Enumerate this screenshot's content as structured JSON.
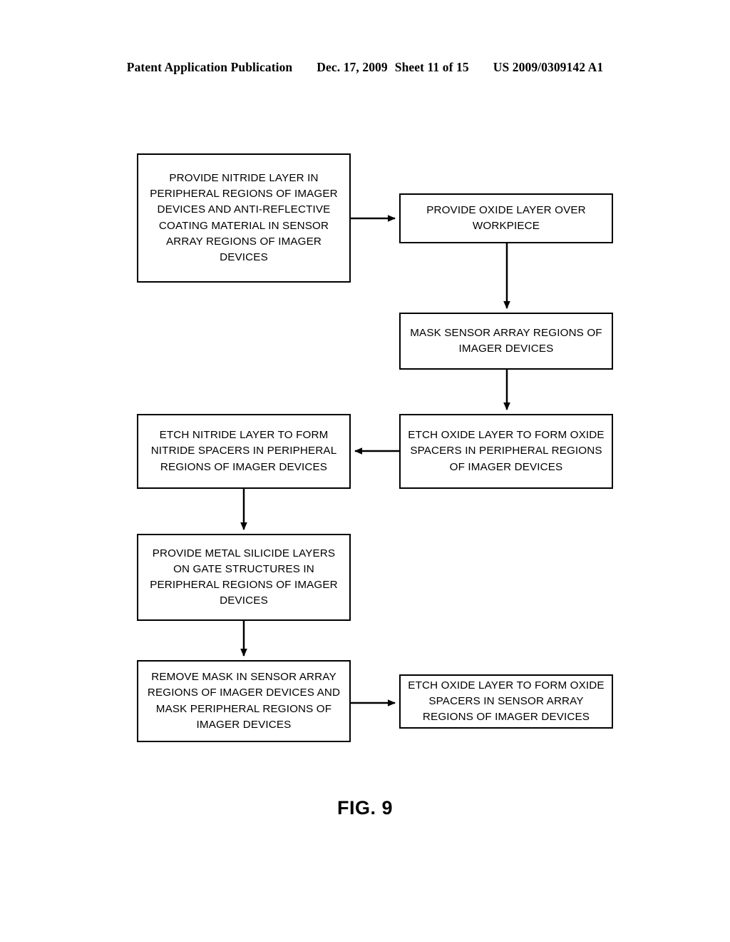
{
  "header": {
    "publication": "Patent Application Publication",
    "date": "Dec. 17, 2009",
    "sheet": "Sheet 11 of 15",
    "document_number": "US 2009/0309142 A1"
  },
  "figure": {
    "caption": "FIG. 9"
  },
  "flowchart": {
    "stroke_color": "#000000",
    "background_color": "#ffffff",
    "boxes": [
      {
        "id": "nitride-arc",
        "text": "PROVIDE NITRIDE LAYER IN PERIPHERAL REGIONS OF IMAGER DEVICES AND ANTI-REFLECTIVE COATING MATERIAL IN SENSOR ARRAY REGIONS OF IMAGER DEVICES"
      },
      {
        "id": "oxide-layer",
        "text": "PROVIDE OXIDE LAYER OVER WORKPIECE"
      },
      {
        "id": "mask-sensor",
        "text": "MASK SENSOR ARRAY REGIONS OF IMAGER DEVICES"
      },
      {
        "id": "etch-nitride",
        "text": "ETCH NITRIDE LAYER TO FORM NITRIDE SPACERS IN PERIPHERAL REGIONS OF IMAGER DEVICES"
      },
      {
        "id": "etch-oxide-peripheral",
        "text": "ETCH OXIDE LAYER TO FORM OXIDE SPACERS IN PERIPHERAL REGIONS OF IMAGER DEVICES"
      },
      {
        "id": "metal-silicide",
        "text": "PROVIDE METAL SILICIDE LAYERS ON GATE STRUCTURES IN PERIPHERAL REGIONS OF IMAGER DEVICES"
      },
      {
        "id": "remove-mask",
        "text": "REMOVE MASK IN SENSOR ARRAY REGIONS OF IMAGER DEVICES AND MASK PERIPHERAL REGIONS OF IMAGER DEVICES"
      },
      {
        "id": "etch-oxide-sensor",
        "text": "ETCH OXIDE LAYER TO FORM OXIDE SPACERS IN SENSOR ARRAY REGIONS OF IMAGER DEVICES"
      }
    ],
    "connectors": [
      {
        "from": "nitride-arc",
        "to": "oxide-layer",
        "direction": "right"
      },
      {
        "from": "oxide-layer",
        "to": "mask-sensor",
        "direction": "down"
      },
      {
        "from": "mask-sensor",
        "to": "etch-oxide-peripheral",
        "direction": "down"
      },
      {
        "from": "etch-oxide-peripheral",
        "to": "etch-nitride",
        "direction": "left"
      },
      {
        "from": "etch-nitride",
        "to": "metal-silicide",
        "direction": "down"
      },
      {
        "from": "metal-silicide",
        "to": "remove-mask",
        "direction": "down"
      },
      {
        "from": "remove-mask",
        "to": "etch-oxide-sensor",
        "direction": "right"
      }
    ]
  }
}
